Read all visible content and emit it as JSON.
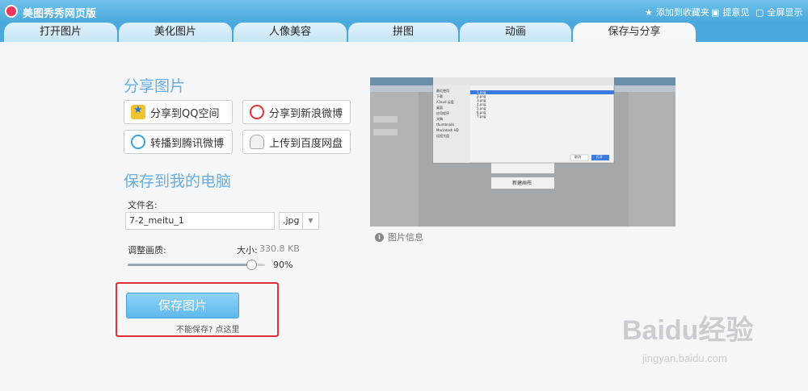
{
  "titlebar": {
    "app_title": "美图秀秀网页版",
    "bookmark": "添加到收藏夹",
    "feedback": "提意见",
    "fullscreen": "全屏显示"
  },
  "tabs": [
    {
      "label": "打开图片"
    },
    {
      "label": "美化图片"
    },
    {
      "label": "人像美容"
    },
    {
      "label": "拼图"
    },
    {
      "label": "动画"
    },
    {
      "label": "保存与分享"
    }
  ],
  "share": {
    "title": "分享图片",
    "qzone": "分享到QQ空间",
    "weibo": "分享到新浪微博",
    "tencent": "转播到腾讯微博",
    "baidu": "上传到百度网盘"
  },
  "save": {
    "title": "保存到我的电脑",
    "filename_label": "文件名:",
    "filename_value": "7-2_meitu_1",
    "format_value": ".jpg",
    "quality_label": "调整画质:",
    "size_label": "大小:",
    "size_value": "330.8 KB",
    "quality_value": "90%",
    "quality_fraction": 0.9,
    "save_button": "保存图片",
    "cant_save": "不能保存? 点这里"
  },
  "preview": {
    "info_label": "图片信息",
    "dialog_files": [
      "1.png",
      "2.png",
      "3.png",
      "4.png",
      "5.png",
      "6.png",
      "7.png"
    ],
    "sidebar_items": [
      "最近使用",
      "下载",
      "iCloud 云盘",
      "桌面",
      "应用程序",
      "文稿",
      "thumbnails"
    ],
    "device_items": [
      "Macintosh HD",
      "远程光盘"
    ],
    "cancel": "取消",
    "ok": "打开",
    "bg_new_canvas": "新建画布"
  },
  "watermark": {
    "brand": "Baidu经验",
    "url": "jingyan.baidu.com"
  },
  "colors": {
    "accent": "#4aa9dc",
    "section_title": "#6aaedf",
    "highlight_box": "#e0303a"
  }
}
